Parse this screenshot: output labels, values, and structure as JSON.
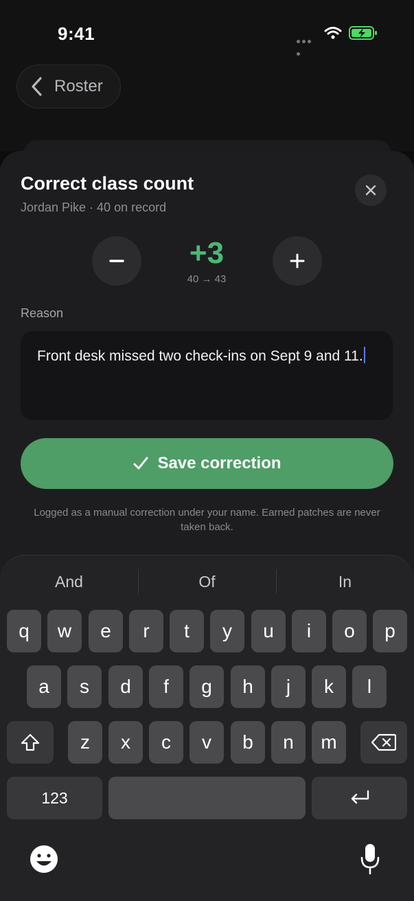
{
  "status_bar": {
    "time": "9:41"
  },
  "nav": {
    "back_label": "Roster"
  },
  "sheet": {
    "title": "Correct class count",
    "subtitle": "Jordan Pike · 40 on record",
    "delta": "+3",
    "delta_detail": "40 → 43",
    "reason_label": "Reason",
    "reason_value": "Front desk missed two check-ins on Sept 9 and 11.",
    "save_label": "Save correction",
    "footnote": "Logged as a manual correction under your name. Earned patches are never taken back."
  },
  "keyboard": {
    "suggestions": [
      "And",
      "Of",
      "In"
    ],
    "row1": [
      "q",
      "w",
      "e",
      "r",
      "t",
      "y",
      "u",
      "i",
      "o",
      "p"
    ],
    "row2": [
      "a",
      "s",
      "d",
      "f",
      "g",
      "h",
      "j",
      "k",
      "l"
    ],
    "row3": [
      "z",
      "x",
      "c",
      "v",
      "b",
      "n",
      "m"
    ],
    "numbers_label": "123"
  },
  "colors": {
    "accent_green": "#4fb775",
    "save_button": "#4f9d67",
    "caret": "#5b7cff"
  }
}
